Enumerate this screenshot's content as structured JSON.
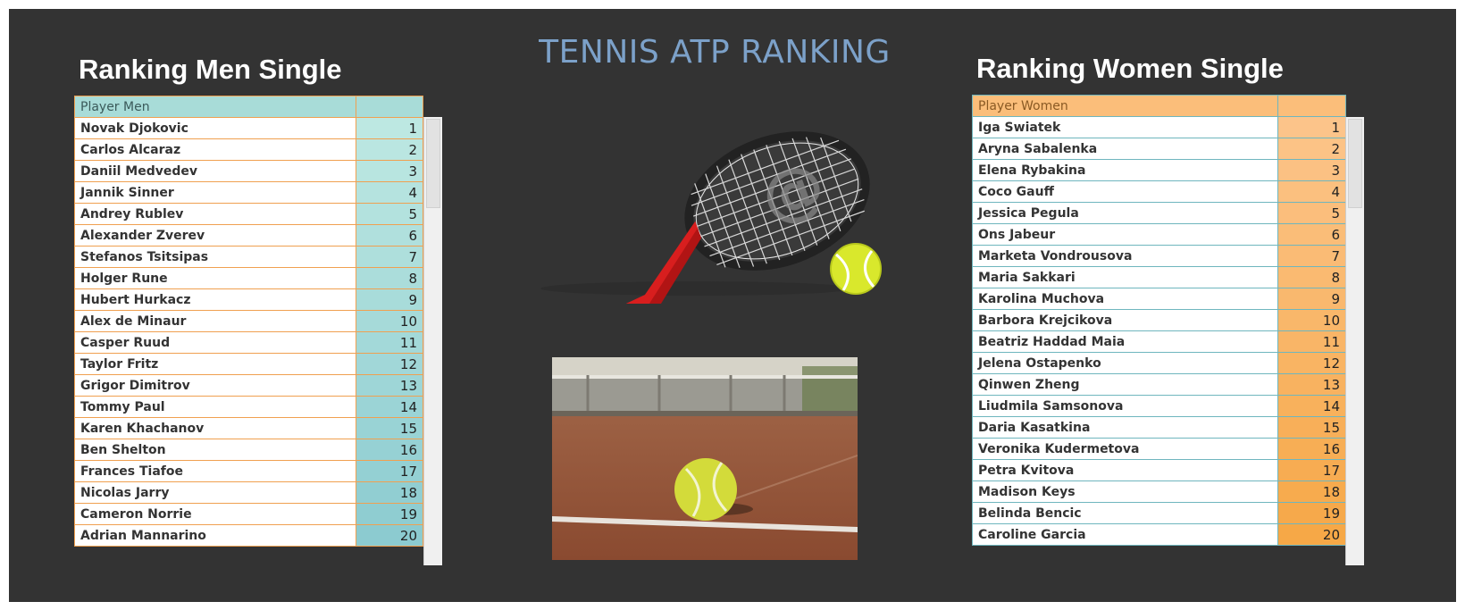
{
  "title": "TENNIS ATP RANKING",
  "men": {
    "heading": "Ranking Men Single",
    "col_header": "Player Men",
    "rank_header": "",
    "rows": [
      {
        "name": "Novak Djokovic",
        "rank": "1"
      },
      {
        "name": "Carlos Alcaraz",
        "rank": "2"
      },
      {
        "name": "Daniil Medvedev",
        "rank": "3"
      },
      {
        "name": "Jannik Sinner",
        "rank": "4"
      },
      {
        "name": "Andrey Rublev",
        "rank": "5"
      },
      {
        "name": "Alexander Zverev",
        "rank": "6"
      },
      {
        "name": "Stefanos Tsitsipas",
        "rank": "7"
      },
      {
        "name": "Holger Rune",
        "rank": "8"
      },
      {
        "name": "Hubert Hurkacz",
        "rank": "9"
      },
      {
        "name": "Alex de Minaur",
        "rank": "10"
      },
      {
        "name": "Casper Ruud",
        "rank": "11"
      },
      {
        "name": "Taylor Fritz",
        "rank": "12"
      },
      {
        "name": "Grigor Dimitrov",
        "rank": "13"
      },
      {
        "name": "Tommy Paul",
        "rank": "14"
      },
      {
        "name": "Karen Khachanov",
        "rank": "15"
      },
      {
        "name": "Ben Shelton",
        "rank": "16"
      },
      {
        "name": "Frances Tiafoe",
        "rank": "17"
      },
      {
        "name": "Nicolas Jarry",
        "rank": "18"
      },
      {
        "name": "Cameron Norrie",
        "rank": "19"
      },
      {
        "name": "Adrian Mannarino",
        "rank": "20"
      }
    ]
  },
  "women": {
    "heading": "Ranking Women Single",
    "col_header": "Player Women",
    "rank_header": "",
    "rows": [
      {
        "name": "Iga Swiatek",
        "rank": "1"
      },
      {
        "name": "Aryna Sabalenka",
        "rank": "2"
      },
      {
        "name": "Elena Rybakina",
        "rank": "3"
      },
      {
        "name": "Coco Gauff",
        "rank": "4"
      },
      {
        "name": "Jessica Pegula",
        "rank": "5"
      },
      {
        "name": "Ons Jabeur",
        "rank": "6"
      },
      {
        "name": "Marketa Vondrousova",
        "rank": "7"
      },
      {
        "name": "Maria Sakkari",
        "rank": "8"
      },
      {
        "name": "Karolina Muchova",
        "rank": "9"
      },
      {
        "name": "Barbora Krejcikova",
        "rank": "10"
      },
      {
        "name": "Beatriz Haddad Maia",
        "rank": "11"
      },
      {
        "name": "Jelena Ostapenko",
        "rank": "12"
      },
      {
        "name": "Qinwen Zheng",
        "rank": "13"
      },
      {
        "name": "Liudmila Samsonova",
        "rank": "14"
      },
      {
        "name": "Daria Kasatkina",
        "rank": "15"
      },
      {
        "name": "Veronika Kudermetova",
        "rank": "16"
      },
      {
        "name": "Petra Kvitova",
        "rank": "17"
      },
      {
        "name": "Madison Keys",
        "rank": "18"
      },
      {
        "name": "Belinda Bencic",
        "rank": "19"
      },
      {
        "name": "Caroline Garcia",
        "rank": "20"
      }
    ]
  },
  "images": {
    "racket": "tennis-racket-icon",
    "court": "tennis-ball-on-clay-court-photo"
  },
  "colors": {
    "background": "#333333",
    "title": "#7ca1c9",
    "men_rank_light": "#bde8e2",
    "men_rank_dark": "#8ccbd0",
    "women_rank_light": "#fcc48a",
    "women_rank_dark": "#f6a847"
  }
}
